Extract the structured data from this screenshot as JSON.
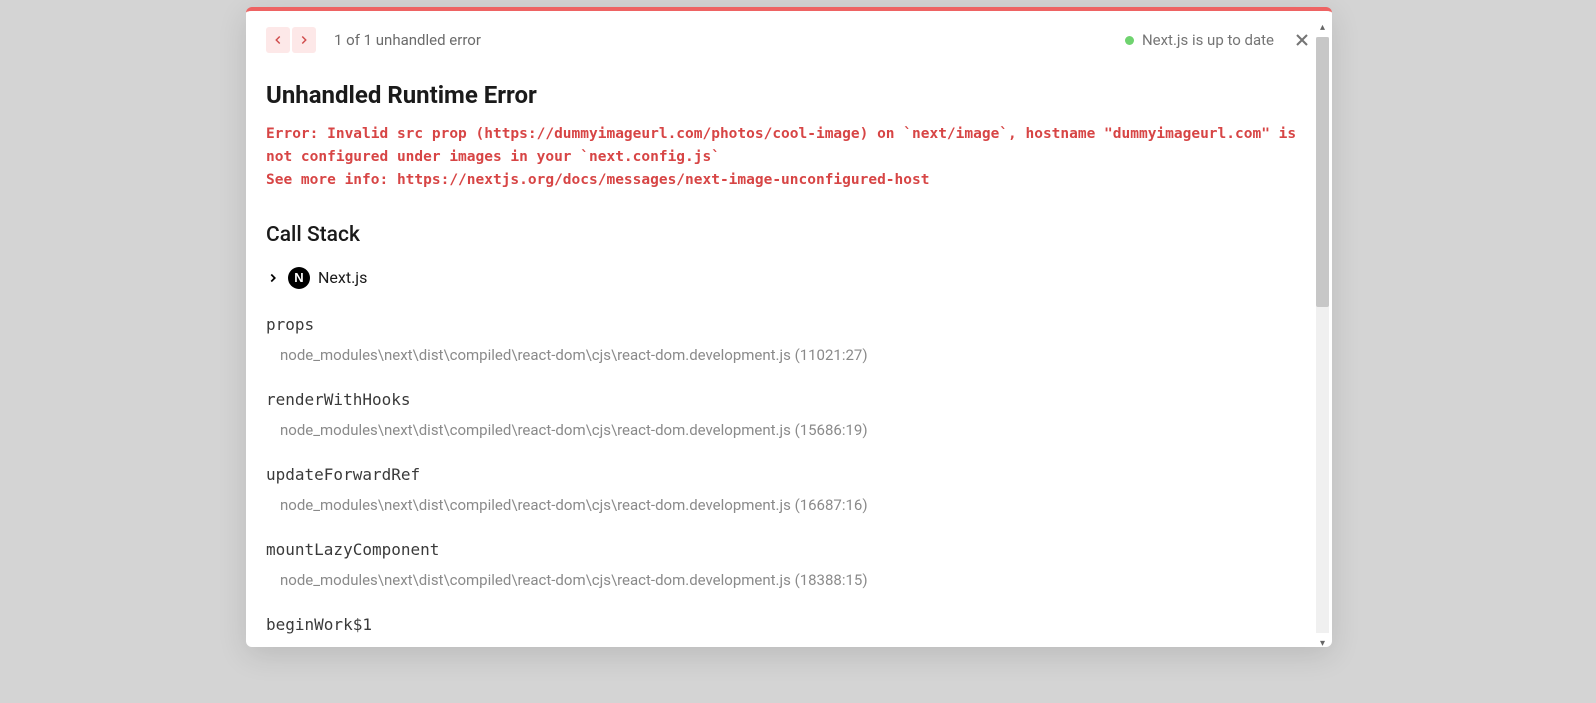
{
  "header": {
    "counter": "1 of 1 unhandled error",
    "status": "Next.js is up to date"
  },
  "error": {
    "title": "Unhandled Runtime Error",
    "message": "Error: Invalid src prop (https://dummyimageurl.com/photos/cool-image) on `next/image`, hostname \"dummyimageurl.com\" is not configured under images in your `next.config.js`\nSee more info: https://nextjs.org/docs/messages/next-image-unconfigured-host"
  },
  "callstack": {
    "title": "Call Stack",
    "framework": "Next.js",
    "frames": [
      {
        "fn": "props",
        "loc": "node_modules\\next\\dist\\compiled\\react-dom\\cjs\\react-dom.development.js (11021:27)"
      },
      {
        "fn": "renderWithHooks",
        "loc": "node_modules\\next\\dist\\compiled\\react-dom\\cjs\\react-dom.development.js (15686:19)"
      },
      {
        "fn": "updateForwardRef",
        "loc": "node_modules\\next\\dist\\compiled\\react-dom\\cjs\\react-dom.development.js (16687:16)"
      },
      {
        "fn": "mountLazyComponent",
        "loc": "node_modules\\next\\dist\\compiled\\react-dom\\cjs\\react-dom.development.js (18388:15)"
      },
      {
        "fn": "beginWork$1",
        "loc": ""
      }
    ]
  }
}
